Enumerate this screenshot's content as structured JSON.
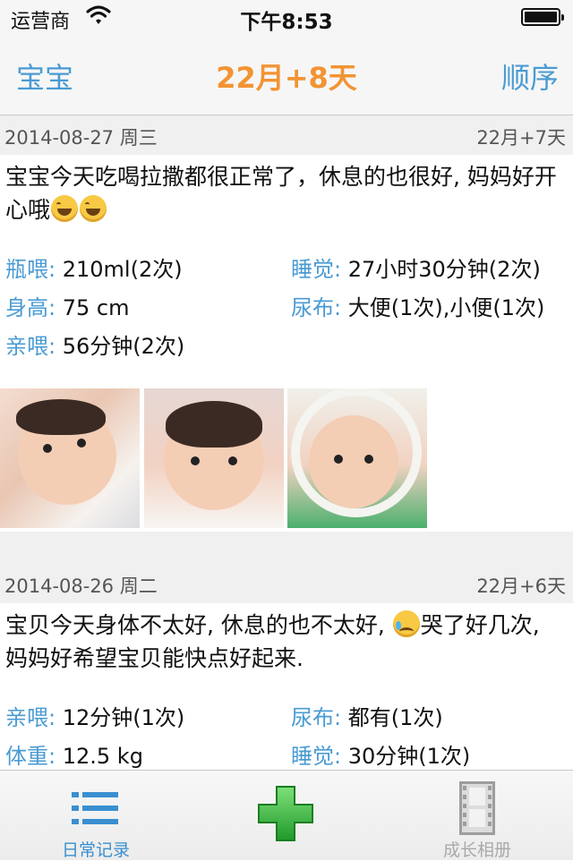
{
  "status_bar": {
    "carrier": "运营商",
    "time": "下午8:53"
  },
  "nav": {
    "left_label": "宝宝",
    "title": "22月+8天",
    "right_label": "顺序"
  },
  "entries": [
    {
      "date": "2014-08-27 周三",
      "age": "22月+7天",
      "text_before": "宝宝今天吃喝拉撒都很正常了，休息的也很好, 妈妈好开心哦",
      "text_after": "",
      "emoji_1": "grinning-face-emoji",
      "stats": [
        {
          "key": "瓶喂:",
          "value": "210ml(2次)"
        },
        {
          "key": "睡觉:",
          "value": "27小时30分钟(2次)"
        },
        {
          "key": "身高:",
          "value": "75 cm"
        },
        {
          "key": "尿布:",
          "value": "大便(1次),小便(1次)"
        },
        {
          "key": "亲喂:",
          "value": "56分钟(2次)"
        }
      ],
      "photo_count": 3
    },
    {
      "date": "2014-08-26 周二",
      "age": "22月+6天",
      "text_before": "宝贝今天身体不太好, 休息的也不太好, ",
      "text_after": "哭了好几次, 妈妈好希望宝贝能快点好起来.",
      "emoji_1": "crying-face-emoji",
      "stats": [
        {
          "key": "亲喂:",
          "value": "12分钟(1次)"
        },
        {
          "key": "尿布:",
          "value": "都有(1次)"
        },
        {
          "key": "体重:",
          "value": "12.5 kg"
        },
        {
          "key": "睡觉:",
          "value": "30分钟(1次)"
        }
      ]
    }
  ],
  "tab_bar": {
    "tabs": [
      {
        "label": "日常记录",
        "icon": "list-icon",
        "active": true
      },
      {
        "label": "",
        "icon": "add-icon",
        "active": false
      },
      {
        "label": "成长相册",
        "icon": "film-icon",
        "active": false
      }
    ]
  },
  "colors": {
    "accent_blue": "#4a9bd3",
    "title_orange": "#f29433",
    "add_green": "#3fbf3f"
  }
}
